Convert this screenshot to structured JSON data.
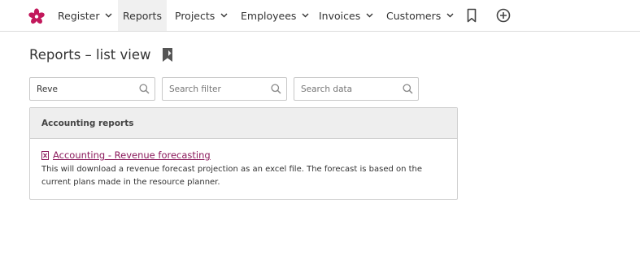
{
  "nav": {
    "items": [
      {
        "label": "Register",
        "has_dropdown": true
      },
      {
        "label": "Reports",
        "has_dropdown": false,
        "active": true
      },
      {
        "label": "Projects",
        "has_dropdown": true
      },
      {
        "label": "Employees",
        "has_dropdown": true
      },
      {
        "label": "Invoices",
        "has_dropdown": true
      },
      {
        "label": "Customers",
        "has_dropdown": true
      }
    ],
    "icons": [
      "logo-flower-icon",
      "bookmark-icon",
      "add-circle-icon"
    ]
  },
  "page": {
    "title": "Reports – list view",
    "title_icon": "bookmark-filled-icon"
  },
  "search": {
    "query_value": "Reve",
    "filter_placeholder": "Search filter",
    "data_placeholder": "Search data"
  },
  "section": {
    "heading": "Accounting reports",
    "reports": [
      {
        "title": "Accounting - Revenue forecasting",
        "icon": "excel-file-icon",
        "description": "This will download a revenue forecast projection as an excel file. The forecast is based on the current plans made in the resource planner."
      }
    ]
  },
  "colors": {
    "brand": "#c2185b",
    "link": "#8b1a5c",
    "border": "#cfcfcf",
    "panel_header_bg": "#eeeeee"
  }
}
